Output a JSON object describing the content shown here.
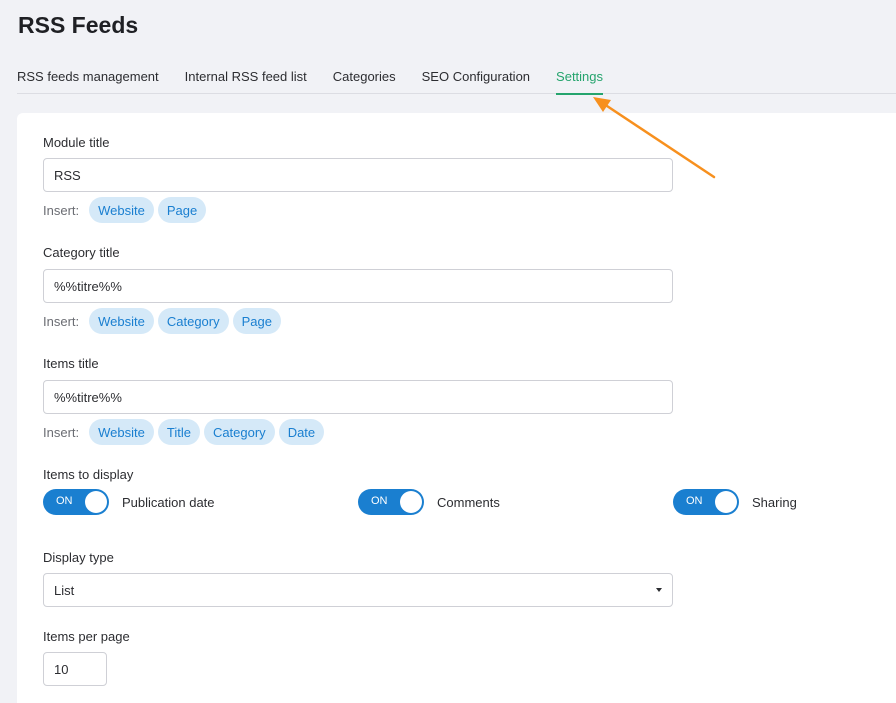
{
  "page": {
    "title": "RSS Feeds"
  },
  "tabs": [
    {
      "label": "RSS feeds management"
    },
    {
      "label": "Internal RSS feed list"
    },
    {
      "label": "Categories"
    },
    {
      "label": "SEO Configuration"
    },
    {
      "label": "Settings"
    }
  ],
  "active_tab": "Settings",
  "form": {
    "insert_label": "Insert:",
    "module_title": {
      "label": "Module title",
      "value": "RSS",
      "chips": [
        "Website",
        "Page"
      ]
    },
    "category_title": {
      "label": "Category title",
      "value": "%%titre%%",
      "chips": [
        "Website",
        "Category",
        "Page"
      ]
    },
    "items_title": {
      "label": "Items title",
      "value": "%%titre%%",
      "chips": [
        "Website",
        "Title",
        "Category",
        "Date"
      ]
    },
    "items_to_display": {
      "label": "Items to display",
      "toggles": [
        {
          "state": "ON",
          "label": "Publication date"
        },
        {
          "state": "ON",
          "label": "Comments"
        },
        {
          "state": "ON",
          "label": "Sharing"
        }
      ]
    },
    "display_type": {
      "label": "Display type",
      "value": "List"
    },
    "items_per_page": {
      "label": "Items per page",
      "value": "10"
    }
  },
  "colors": {
    "accent_green": "#25a46d",
    "toggle_blue": "#1a7fd0",
    "chip_bg": "#d5e9f8",
    "annotation_arrow": "#f7901e"
  }
}
